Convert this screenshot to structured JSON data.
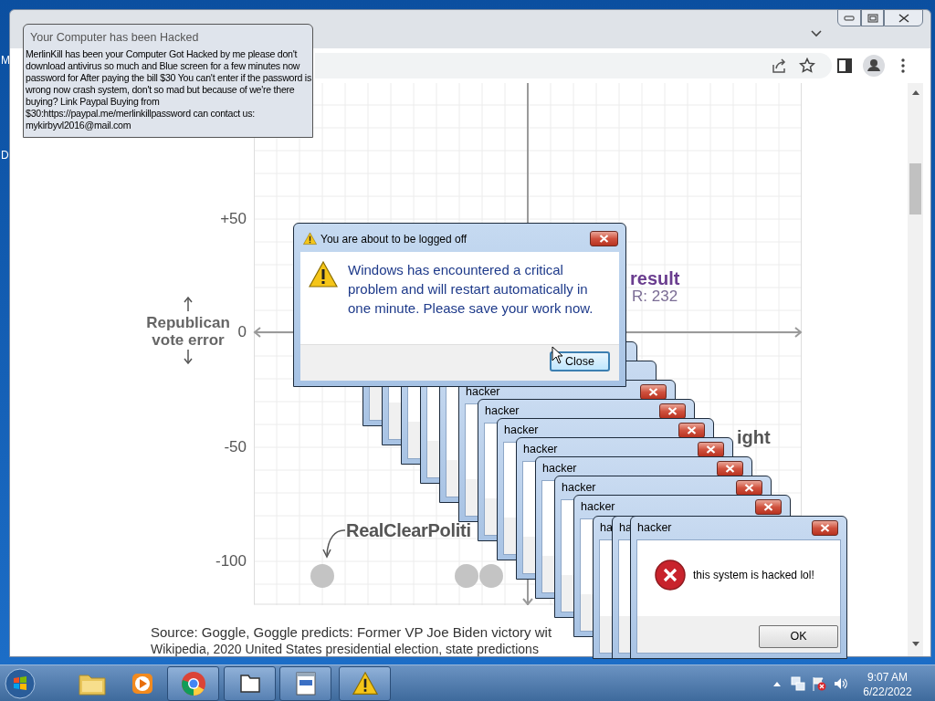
{
  "desktop": {
    "icon_labels": [
      "M",
      "D"
    ]
  },
  "browser": {
    "chart": {
      "y_ticks": [
        "+50",
        "0",
        "-50",
        "-100"
      ],
      "y_axis_label": "Republican vote error",
      "labels": [
        {
          "kind": "result",
          "text": "result"
        },
        {
          "kind": "sub",
          "text": "R: 232"
        },
        {
          "kind": "side",
          "text": "ight"
        },
        {
          "kind": "callout",
          "text": "RealClearPoliti"
        }
      ]
    },
    "source_lines": [
      "Source: Goggle, Goggle predicts: Former VP Joe Biden victory wit",
      "Wikipedia, 2020 United States presidential election, state predictions"
    ]
  },
  "notice": {
    "title": "Your Computer has been Hacked",
    "body": "MerlinKill has been your Computer Got Hacked by me please don't download antivirus so much and Blue screen for a few minutes now password for After paying the bill $30 You can't enter if the password is wrong now crash system, don't so mad but because of we're there buying? Link Paypal Buying from $30:https://paypal.me/merlinkillpassword can contact us: mykirbyvl2016@mail.com"
  },
  "logoff_dialog": {
    "title": "You are about to be logged off",
    "message": "Windows has encountered a critical problem and will restart automatically in one minute. Please save your work now.",
    "button": "Close"
  },
  "hacker_windows": [
    {
      "kind": "covered"
    },
    {
      "kind": "covered"
    },
    {
      "kind": "covered"
    },
    {
      "kind": "covered"
    },
    {
      "kind": "covered"
    },
    {
      "kind": "titled",
      "title": "hacker"
    },
    {
      "kind": "titled",
      "title": "hacker"
    },
    {
      "kind": "titled",
      "title": "hacker"
    },
    {
      "kind": "titled",
      "title": "hacker"
    },
    {
      "kind": "titled",
      "title": "hacker"
    },
    {
      "kind": "titled",
      "title": "hacker"
    },
    {
      "kind": "titled",
      "title": "hacker"
    },
    {
      "kind": "titled",
      "title": "ha"
    },
    {
      "kind": "titled",
      "title": "ha"
    },
    {
      "kind": "message",
      "title": "hacker",
      "message": "this system is hacked lol!",
      "button": "OK"
    }
  ],
  "taskbar": {
    "buttons": [
      {
        "kind": "folder"
      },
      {
        "kind": "media"
      },
      {
        "kind": "chrome"
      },
      {
        "kind": "window"
      },
      {
        "kind": "notepad"
      },
      {
        "kind": "warning"
      }
    ],
    "time": "9:07 AM",
    "date": "6/22/2022"
  }
}
